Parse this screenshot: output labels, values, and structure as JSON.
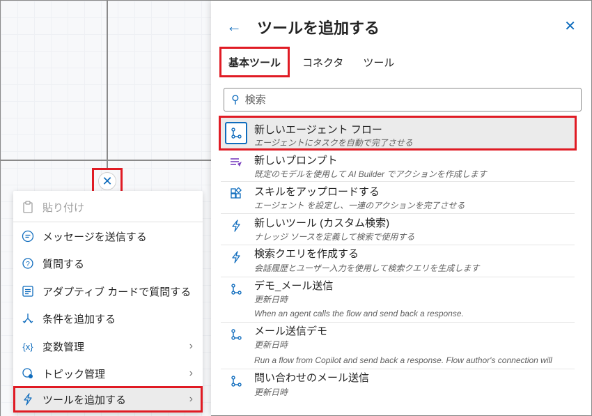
{
  "canvas": {
    "close_node_icon": "close-icon"
  },
  "context_menu": {
    "items": [
      {
        "label": "貼り付け",
        "icon": "paste-icon",
        "disabled": true
      },
      {
        "label": "メッセージを送信する",
        "icon": "message-icon"
      },
      {
        "label": "質問する",
        "icon": "question-icon"
      },
      {
        "label": "アダプティブ カードで質問する",
        "icon": "card-icon"
      },
      {
        "label": "条件を追加する",
        "icon": "branch-icon"
      },
      {
        "label": "変数管理",
        "icon": "variable-icon",
        "submenu": true
      },
      {
        "label": "トピック管理",
        "icon": "topic-icon",
        "submenu": true
      },
      {
        "label": "ツールを追加する",
        "icon": "lightning-icon",
        "submenu": true,
        "active": true
      }
    ]
  },
  "panel": {
    "title": "ツールを追加する",
    "tabs": [
      "基本ツール",
      "コネクタ",
      "ツール"
    ],
    "search_placeholder": "検索",
    "tools": [
      {
        "title": "新しいエージェント フロー",
        "desc": "エージェントにタスクを自動で完了させる",
        "icon": "flow-icon",
        "highlight": true
      },
      {
        "title": "新しいプロンプト",
        "desc": "既定のモデルを使用して AI Builder でアクションを作成します",
        "icon": "prompt-icon"
      },
      {
        "title": "スキルをアップロードする",
        "desc": "エージェント を設定し、一連のアクションを完了させる",
        "icon": "skill-icon"
      },
      {
        "title": "新しいツール (カスタム検索)",
        "desc": "ナレッジ ソースを定義して検索で使用する",
        "icon": "lightning-icon"
      },
      {
        "title": "検索クエリを作成する",
        "desc": "会話履歴とユーザー入力を使用して検索クエリを生成します",
        "icon": "lightning-icon"
      },
      {
        "title": "デモ_メール送信",
        "desc": "更新日時",
        "desc2": "When an agent calls the flow and send back a response.",
        "icon": "flow-icon"
      },
      {
        "title": "メール送信デモ",
        "desc": "更新日時",
        "desc2": "Run a flow from Copilot and send back a response. Flow author's connection will",
        "icon": "flow-icon"
      },
      {
        "title": "問い合わせのメール送信",
        "desc": "更新日時",
        "icon": "flow-icon"
      }
    ]
  },
  "colors": {
    "accent": "#0f6cbd",
    "highlight_border": "#e01b24",
    "prompt_icon": "#7a3fbf"
  }
}
